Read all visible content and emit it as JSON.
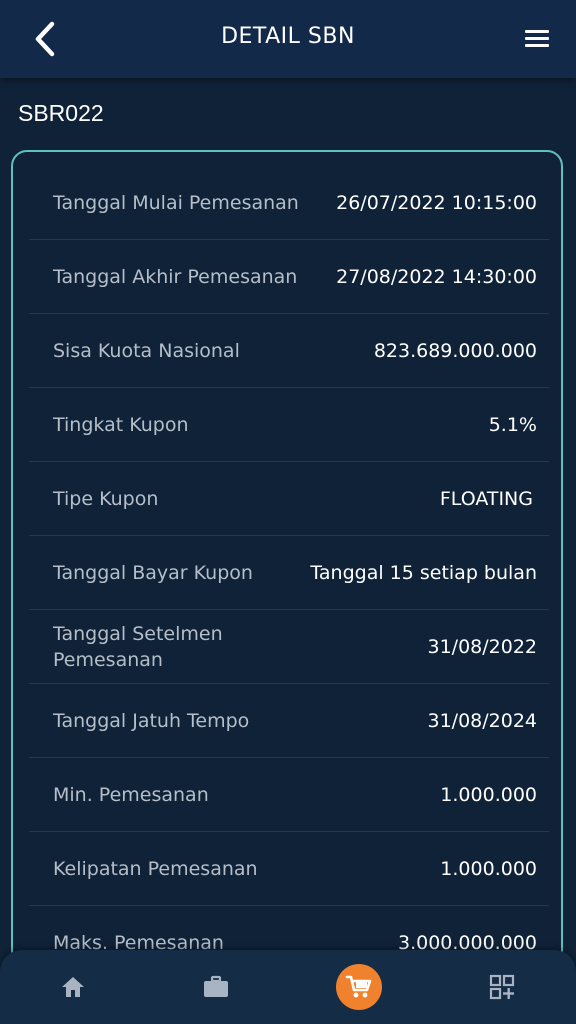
{
  "header": {
    "title": "DETAIL SBN"
  },
  "sbn": {
    "code": "SBR022"
  },
  "details": [
    {
      "label": "Tanggal Mulai Pemesanan",
      "value": "26/07/2022 10:15:00"
    },
    {
      "label": "Tanggal Akhir Pemesanan",
      "value": "27/08/2022 14:30:00"
    },
    {
      "label": "Sisa Kuota Nasional",
      "value": "823.689.000.000"
    },
    {
      "label": "Tingkat Kupon",
      "value": "5.1%"
    },
    {
      "label": "Tipe Kupon",
      "value": "FLOATING"
    },
    {
      "label": "Tanggal Bayar Kupon",
      "value": "Tanggal 15 setiap bulan"
    },
    {
      "label": "Tanggal Setelmen Pemesanan",
      "value": "31/08/2022"
    },
    {
      "label": "Tanggal Jatuh Tempo",
      "value": "31/08/2024"
    },
    {
      "label": "Min. Pemesanan",
      "value": "1.000.000"
    },
    {
      "label": "Kelipatan Pemesanan",
      "value": "1.000.000"
    },
    {
      "label": "Maks. Pemesanan",
      "value": "3.000.000.000"
    }
  ],
  "nav": {
    "items": [
      "home-icon",
      "briefcase-icon",
      "cart-icon",
      "qr-add-icon"
    ],
    "active": "cart-icon",
    "accent": "#f0822d"
  },
  "colors": {
    "background": "#0f2238",
    "card_border": "#5fc0bd",
    "header": "#13294a"
  }
}
